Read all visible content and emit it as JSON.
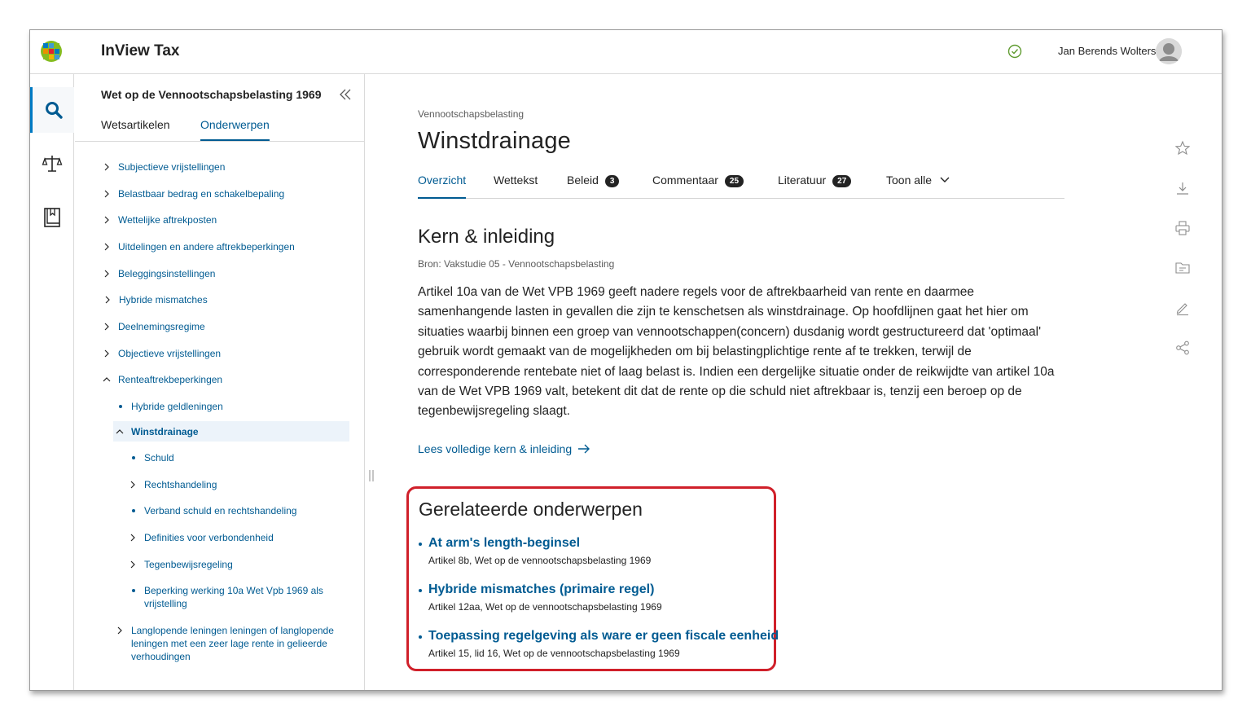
{
  "header": {
    "app_title": "InView Tax",
    "user_name": "Jan Berends Wolters"
  },
  "nav": {
    "title": "Wet op de Vennootschapsbelasting 1969",
    "tabs": [
      "Wetsartikelen",
      "Onderwerpen"
    ],
    "active_tab": "Onderwerpen",
    "items": [
      {
        "label": "Subjectieve vrijstellingen",
        "type": "collapsed"
      },
      {
        "label": "Belastbaar bedrag en schakelbepaling",
        "type": "collapsed"
      },
      {
        "label": "Wettelijke aftrekposten",
        "type": "collapsed"
      },
      {
        "label": "Uitdelingen en andere aftrekbeperkingen",
        "type": "collapsed"
      },
      {
        "label": "Beleggingsinstellingen",
        "type": "collapsed"
      },
      {
        "label": "Hybride mismatches",
        "type": "collapsed"
      },
      {
        "label": "Deelnemingsregime",
        "type": "collapsed"
      },
      {
        "label": "Objectieve vrijstellingen",
        "type": "collapsed"
      },
      {
        "label": "Renteaftrekbeperkingen",
        "type": "expanded"
      },
      {
        "label": "Hybride geldleningen",
        "type": "leaf"
      },
      {
        "label": "Winstdrainage",
        "type": "expanded-selected"
      },
      {
        "label": "Schuld",
        "type": "leaf"
      },
      {
        "label": "Rechtshandeling",
        "type": "collapsed"
      },
      {
        "label": "Verband schuld en rechtshandeling",
        "type": "leaf"
      },
      {
        "label": "Definities voor verbondenheid",
        "type": "collapsed"
      },
      {
        "label": "Tegenbewijsregeling",
        "type": "collapsed"
      },
      {
        "label": "Beperking werking 10a Wet Vpb 1969 als vrijstelling",
        "type": "leaf"
      },
      {
        "label": "Langlopende leningen leningen of langlopende leningen met een zeer lage rente in gelieerde verhoudingen",
        "type": "collapsed"
      }
    ]
  },
  "main": {
    "breadcrumb": "Vennootschapsbelasting",
    "title": "Winstdrainage",
    "tabs": [
      {
        "label": "Overzicht",
        "badge": null,
        "active": true
      },
      {
        "label": "Wettekst",
        "badge": null
      },
      {
        "label": "Beleid",
        "badge": "3"
      },
      {
        "label": "Commentaar",
        "badge": "25"
      },
      {
        "label": "Literatuur",
        "badge": "27"
      },
      {
        "label": "Toon alle",
        "badge": null
      }
    ],
    "section_title": "Kern & inleiding",
    "source": "Bron: Vakstudie 05 - Vennootschapsbelasting",
    "body": "Artikel 10a van de Wet VPB 1969 geeft nadere regels voor de aftrekbaarheid van rente en daarmee samenhangende lasten in gevallen die zijn te kenschetsen als winstdrainage. Op hoofdlijnen gaat het hier om situaties waarbij binnen een groep van vennootschappen(concern) dusdanig wordt gestructureerd dat 'optimaal' gebruik wordt gemaakt van de mogelijkheden om bij belastingplichtige rente af te trekken, terwijl de corresponderende rentebate niet of laag belast is. Indien een dergelijke situatie onder de reikwijdte van artikel 10a van de Wet VPB 1969 valt, betekent dit dat de rente op die schuld niet aftrekbaar is, tenzij een beroep op de tegenbewijsregeling slaagt.",
    "read_more": "Lees volledige kern & inleiding",
    "related": {
      "title": "Gerelateerde onderwerpen",
      "items": [
        {
          "title": "At arm's length-beginsel",
          "sub": "Artikel 8b, Wet op de vennootschapsbelasting 1969"
        },
        {
          "title": "Hybride mismatches (primaire regel)",
          "sub": "Artikel 12aa, Wet op de vennootschapsbelasting 1969"
        },
        {
          "title": "Toepassing regelgeving als ware er geen fiscale eenheid",
          "sub": "Artikel 15, lid 16, Wet op de vennootschapsbelasting 1969"
        }
      ]
    }
  },
  "colors": {
    "link": "#005b92",
    "accent": "#007ac3",
    "highlight_border": "#d0202a",
    "status_ok": "#5e9a2e"
  },
  "icons": {
    "rail": [
      "search-icon",
      "scales-icon",
      "book-icon"
    ],
    "tools": [
      "star-icon",
      "download-icon",
      "print-icon",
      "folder-icon",
      "annotate-icon",
      "share-icon"
    ]
  }
}
